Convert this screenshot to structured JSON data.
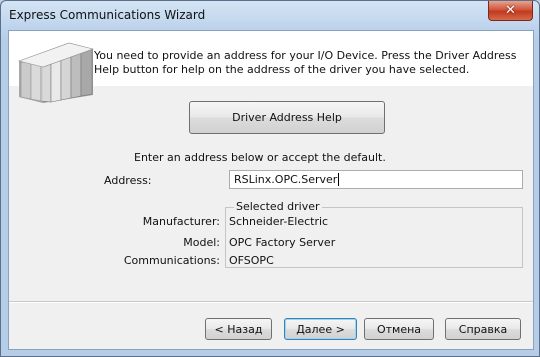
{
  "window": {
    "title": "Express Communications Wizard",
    "close_glyph": "✕"
  },
  "header": {
    "instruction": "You need to provide an address for your I/O Device. Press the Driver Address Help button for help on the address of the driver you have selected.",
    "logo_icon": "io-rack-icon"
  },
  "main": {
    "driver_help_label": "Driver Address Help",
    "enter_prompt": "Enter an address below or accept the default.",
    "address_label": "Address:",
    "address_value": "RSLinx.OPC.Server"
  },
  "selected_driver": {
    "legend": "Selected driver",
    "manufacturer_label": "Manufacturer:",
    "manufacturer_value": "Schneider-Electric",
    "model_label": "Model:",
    "model_value": "OPC Factory Server",
    "communications_label": "Communications:",
    "communications_value": "OFSOPC"
  },
  "footer": {
    "back_label": "< Назад",
    "next_label": "Далее >",
    "cancel_label": "Отмена",
    "help_label": "Справка"
  }
}
